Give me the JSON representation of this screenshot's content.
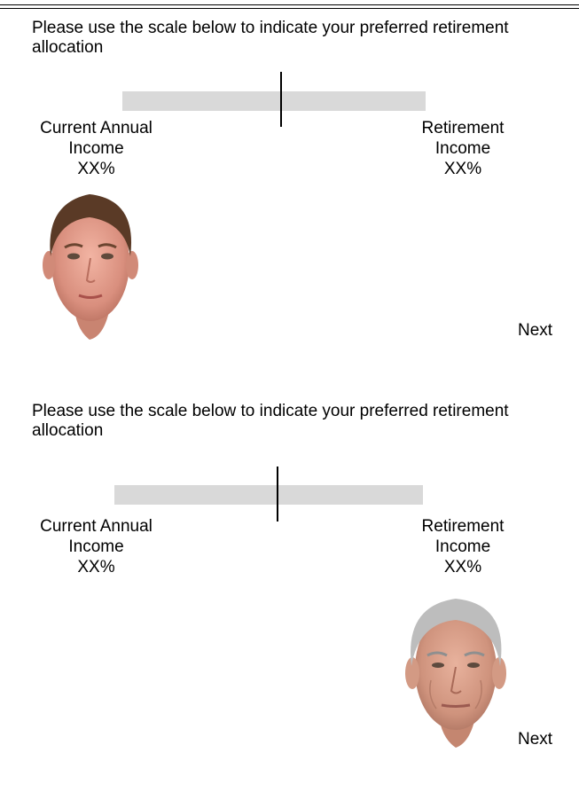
{
  "screens": [
    {
      "prompt": "Please use the scale below to indicate your preferred retirement allocation",
      "left_label_line1": "Current Annual",
      "left_label_line2": "Income",
      "left_percent": "XX%",
      "right_label_line1": "Retirement",
      "right_label_line2": "Income",
      "right_percent": "XX%",
      "next_label": "Next",
      "slider_value": 0.5,
      "avatar": "young-face"
    },
    {
      "prompt": "Please use the scale below to indicate your preferred retirement allocation",
      "left_label_line1": "Current Annual",
      "left_label_line2": "Income",
      "left_percent": "XX%",
      "right_label_line1": "Retirement",
      "right_label_line2": "Income",
      "right_percent": "XX%",
      "next_label": "Next",
      "slider_value": 0.5,
      "avatar": "aged-face"
    }
  ],
  "colors": {
    "track": "#d9d9d9",
    "marker": "#000000",
    "text": "#000000",
    "background": "#ffffff"
  }
}
